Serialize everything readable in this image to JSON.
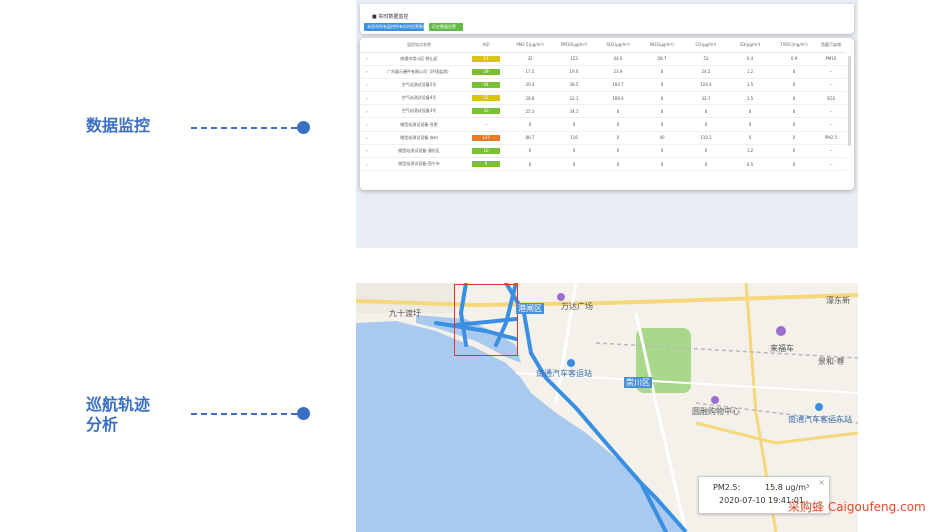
{
  "features": [
    {
      "label_line1": "数据监控",
      "label_line2": ""
    },
    {
      "label_line1": "巡航轨迹",
      "label_line2": "分析"
    }
  ],
  "monitor": {
    "title": "实时数据监控",
    "btn_primary": "本班车所有监控所有实时告警数据",
    "btn_secondary": "历史数据告警",
    "columns": [
      "监控站点名称",
      "AQI",
      "PM2.5(μg/m³)",
      "PM10(μg/m³)",
      "SO2(μg/m³)",
      "NO2(μg/m³)",
      "CO(μg/m³)",
      "O3(μg/m³)",
      "TVOC(mg/m³)",
      "首要污染物"
    ],
    "rows": [
      {
        "name": "南通市崇川区-狼山区",
        "aqi": "67",
        "aqi_color": "#d9c21a",
        "pm25": "32",
        "pm10": "123",
        "so2": "44.6",
        "no2": "58.7",
        "co": "52",
        "o3": "0.4",
        "tvoc": "0.9",
        "primary": "PM10"
      },
      {
        "name": "广东展示硬件有限公司（环境监测）",
        "aqi": "29",
        "aqi_color": "#7bbf34",
        "pm25": "17.5",
        "pm10": "19.0",
        "so2": "23.9",
        "no2": "0",
        "co": "24.2",
        "o3": "1.2",
        "tvoc": "0",
        "primary": "--"
      },
      {
        "name": "空气站测试设备5号",
        "aqi": "44",
        "aqi_color": "#7bbf34",
        "pm25": "30.4",
        "pm10": "38.5",
        "so2": "104.7",
        "no2": "0",
        "co": "124.4",
        "o3": "1.5",
        "tvoc": "0",
        "primary": "--"
      },
      {
        "name": "空气站测试设备4号",
        "aqi": "52",
        "aqi_color": "#d9c21a",
        "pm25": "28.8",
        "pm10": "32.1",
        "so2": "109.4",
        "no2": "0",
        "co": "32.7",
        "o3": "1.5",
        "tvoc": "0",
        "primary": "SO2"
      },
      {
        "name": "空气站测试设备3号",
        "aqi": "43",
        "aqi_color": "#7bbf34",
        "pm25": "25.3",
        "pm10": "34.1",
        "so2": "0",
        "no2": "0",
        "co": "0",
        "o3": "0",
        "tvoc": "0",
        "primary": "--"
      },
      {
        "name": "微型站测试设备-合肥",
        "aqi": "--",
        "aqi_color": "",
        "pm25": "0",
        "pm10": "0",
        "so2": "0",
        "no2": "0",
        "co": "0",
        "o3": "0",
        "tvoc": "0",
        "primary": "--"
      },
      {
        "name": "微型站测试设备-苏州",
        "aqi": "137",
        "aqi_color": "#e8782a",
        "pm25": "86.7",
        "pm10": "116",
        "so2": "0",
        "no2": "40",
        "co": "110.5",
        "o3": "0",
        "tvoc": "0",
        "primary": "PM2.5"
      },
      {
        "name": "微型站测试设备-浦东区",
        "aqi": "10",
        "aqi_color": "#7bbf34",
        "pm25": "6",
        "pm10": "0",
        "so2": "0",
        "no2": "0",
        "co": "0",
        "o3": "1.2",
        "tvoc": "0",
        "primary": "--"
      },
      {
        "name": "微型站测试设备-西宁市",
        "aqi": "9",
        "aqi_color": "#7bbf34",
        "pm25": "6",
        "pm10": "0",
        "so2": "0",
        "no2": "0",
        "co": "0",
        "o3": "0.5",
        "tvoc": "0",
        "primary": "--"
      }
    ]
  },
  "map": {
    "labels": {
      "jiushiban": "九十渡圩",
      "wanda": "万达广场",
      "bus_station": "南通汽车客运站",
      "chongchuan": "崇川区",
      "gangzha": "港闸区",
      "center": "圆融购物中心",
      "bus_station2": "南通汽车客运东站",
      "laifu": "来福车",
      "jinghe": "景和·尊",
      "lanshan": "濠东新"
    },
    "tooltip": {
      "pollutant": "PM2.5:",
      "value": "15.8 ug/m³",
      "time": "2020-07-10 19:41:01",
      "close": "×"
    }
  },
  "watermark": "采购蜂 Caigoufeng.com"
}
